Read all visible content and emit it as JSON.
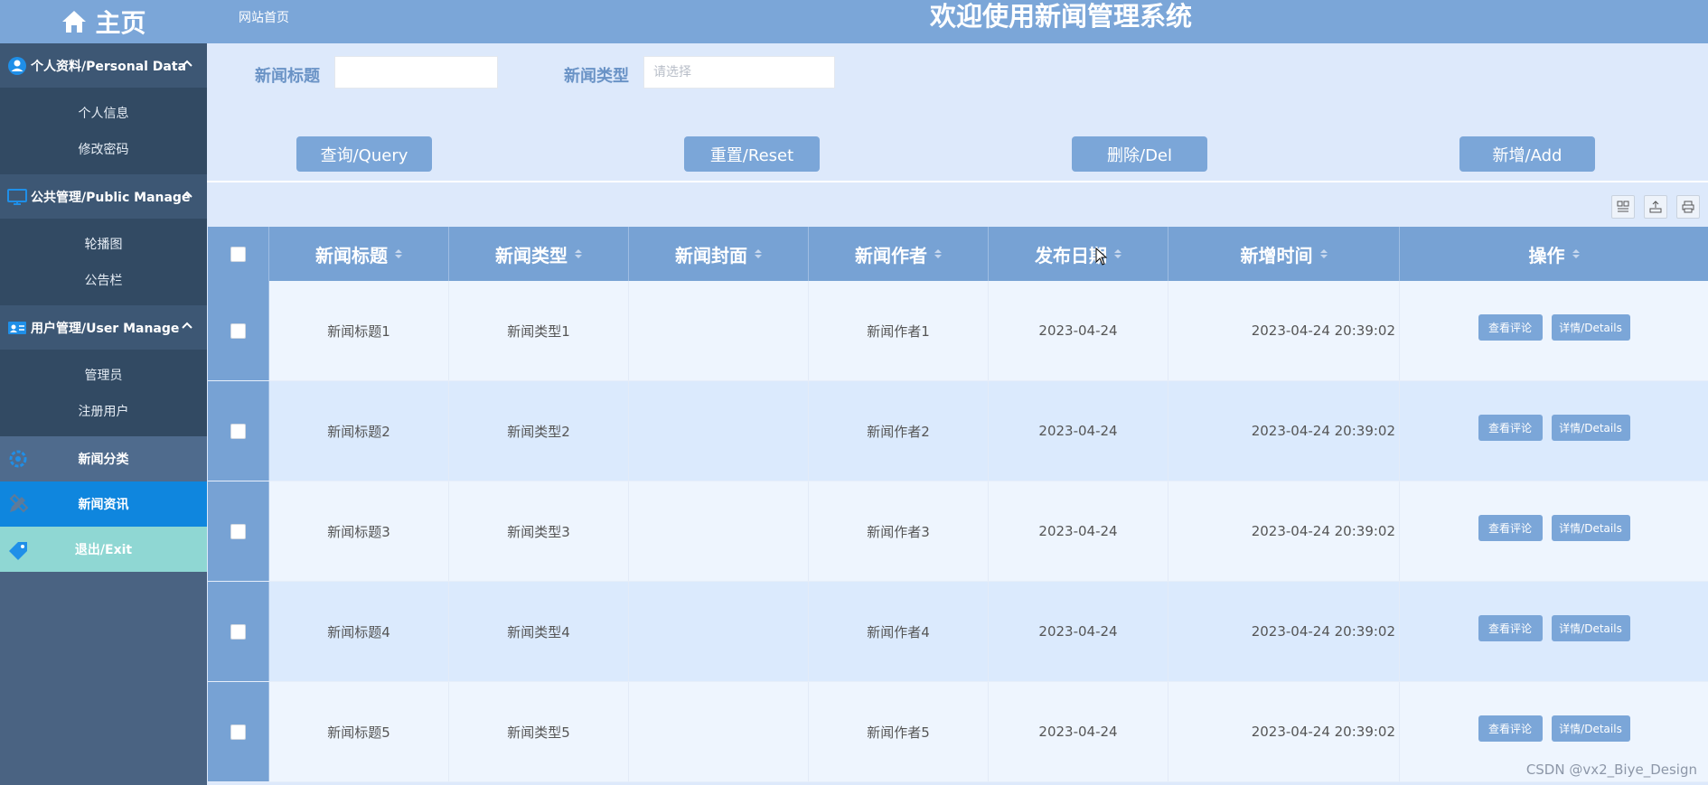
{
  "sidebar": {
    "home_label": "主页",
    "groups": [
      {
        "label": "个人资料/Personal Data",
        "icon": "user-circle-icon",
        "items": [
          "个人信息",
          "修改密码"
        ]
      },
      {
        "label": "公共管理/Public Manage",
        "icon": "monitor-icon",
        "items": [
          "轮播图",
          "公告栏"
        ]
      },
      {
        "label": "用户管理/User Manage",
        "icon": "id-card-icon",
        "items": [
          "管理员",
          "注册用户"
        ]
      }
    ],
    "items": [
      {
        "label": "新闻分类",
        "icon": "gear-icon"
      },
      {
        "label": "新闻资讯",
        "icon": "pencil-ruler-icon"
      },
      {
        "label": "退出/Exit",
        "icon": "tag-icon"
      }
    ]
  },
  "header": {
    "breadcrumb": "网站首页",
    "title": "欢迎使用新闻管理系统"
  },
  "search": {
    "title_label": "新闻标题",
    "title_value": "",
    "type_label": "新闻类型",
    "type_placeholder": "请选择"
  },
  "actions": {
    "query": "查询/Query",
    "reset": "重置/Reset",
    "delete": "删除/Del",
    "add": "新增/Add"
  },
  "toolbar_icons": [
    "columns-icon",
    "export-icon",
    "print-icon"
  ],
  "table": {
    "columns": [
      "新闻标题",
      "新闻类型",
      "新闻封面",
      "新闻作者",
      "发布日期",
      "新增时间",
      "操作"
    ],
    "rows": [
      {
        "title": "新闻标题1",
        "type": "新闻类型1",
        "cover": "",
        "author": "新闻作者1",
        "date": "2023-04-24",
        "created": "2023-04-24 20:39:02"
      },
      {
        "title": "新闻标题2",
        "type": "新闻类型2",
        "cover": "",
        "author": "新闻作者2",
        "date": "2023-04-24",
        "created": "2023-04-24 20:39:02"
      },
      {
        "title": "新闻标题3",
        "type": "新闻类型3",
        "cover": "",
        "author": "新闻作者3",
        "date": "2023-04-24",
        "created": "2023-04-24 20:39:02"
      },
      {
        "title": "新闻标题4",
        "type": "新闻类型4",
        "cover": "",
        "author": "新闻作者4",
        "date": "2023-04-24",
        "created": "2023-04-24 20:39:02"
      },
      {
        "title": "新闻标题5",
        "type": "新闻类型5",
        "cover": "",
        "author": "新闻作者5",
        "date": "2023-04-24",
        "created": "2023-04-24 20:39:02"
      }
    ],
    "row_actions": {
      "comments": "查看评论",
      "details": "详情/Details"
    }
  },
  "watermark": "CSDN @vx2_Biye_Design",
  "colors": {
    "accent": "#7ba6d8",
    "sidebar": "#4a6382",
    "active": "#0f86de",
    "exit": "#8fd7d3",
    "background": "#dde9fb"
  }
}
